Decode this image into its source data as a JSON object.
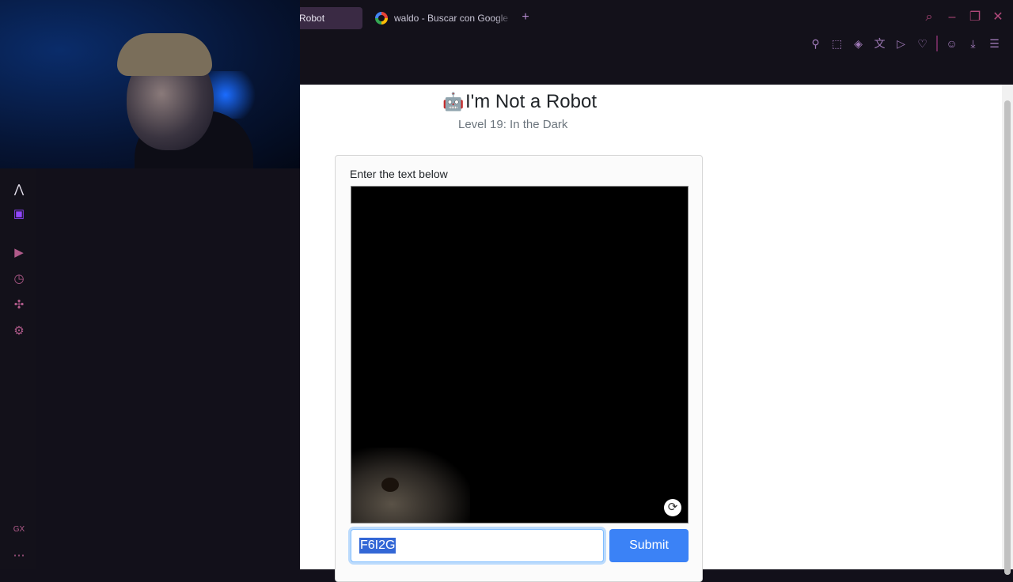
{
  "browser": {
    "tabs": [
      {
        "label": "Robot",
        "active": true
      },
      {
        "label": "waldo - Buscar con Google",
        "active": false
      }
    ],
    "new_tab_icon": "plus-icon",
    "window_controls": [
      "search-icon",
      "minimize-icon",
      "restore-icon",
      "close-icon"
    ],
    "toolbar_icons": [
      "pin-icon",
      "snapshot-icon",
      "pocket-icon",
      "translate-icon",
      "send-icon",
      "heart-icon",
      "account-icon",
      "download-icon",
      "menu-icon"
    ],
    "accent_color": "#b0487a"
  },
  "sidebar": {
    "items": [
      "aria-icon",
      "twitch-icon",
      "player-icon",
      "history-icon",
      "extensions-icon",
      "settings-icon"
    ],
    "gx_label": "GX",
    "more_icon": "more-icon"
  },
  "page": {
    "title": "I'm Not a Robot",
    "subtitle": "Level 19: In the Dark",
    "card_label": "Enter the text below",
    "input_value": "F6I2G",
    "submit_label": "Submit"
  }
}
